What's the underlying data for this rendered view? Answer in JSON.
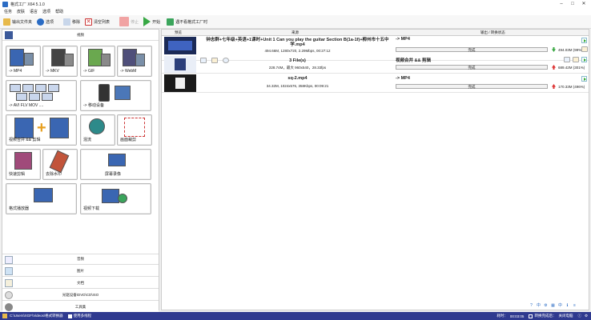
{
  "app": {
    "title": "格式工厂 X64 5.1.0"
  },
  "menu": [
    "任务",
    "皮肤",
    "语言",
    "选项",
    "帮助"
  ],
  "toolbar": {
    "output_folder": "输出文件夹",
    "options": "选项",
    "remove": "移除",
    "clear_list": "清空列表",
    "stop": "停止",
    "start": "开始",
    "download_label": "遇不看格式工厂时"
  },
  "left": {
    "video_header": "视频",
    "tiles": [
      {
        "label": "-> MP4"
      },
      {
        "label": "-> MKV"
      },
      {
        "label": "-> GIF"
      },
      {
        "label": "-> WebM"
      },
      {
        "label": "-> AVI FLV MOV ...."
      },
      {
        "label": "-> 移动设备"
      },
      {
        "label": "视频合并 && 剪辑"
      },
      {
        "label": "混流"
      },
      {
        "label": "画面裁剪"
      },
      {
        "label": "快速剪辑"
      },
      {
        "label": "去除水印"
      },
      {
        "label": "屏幕录像"
      },
      {
        "label": "格式播放器"
      },
      {
        "label": "视频下载"
      }
    ],
    "categories": [
      "音频",
      "图片",
      "文档",
      "光驱设备\\DVD\\CD\\ISO",
      "工具集"
    ]
  },
  "table": {
    "headers": {
      "preview": "预览",
      "source": "来源",
      "output": "输出 / 转换状态"
    },
    "rows": [
      {
        "name": "钟志群+七年级+英语+1课时+Unit 1 Can you play the guitar Section B(1a-1f)+柳州市十五中学.mp4",
        "info": "494.66M, 1280x720, 2.29Mbps, 00:27:12",
        "format": "-> MP4",
        "status": "完成",
        "size": "494.03M",
        "percent": "(99%)"
      },
      {
        "name": "3 File(s)",
        "info": "228.74M，最大 960x540，28.33fps",
        "format": "视频合并 && 剪辑",
        "status": "完成",
        "size": "689.42M",
        "percent": "(301%)"
      },
      {
        "name": "sq-2.mp4",
        "info": "34.32M, 1024x576, 358Kbps, 00:09:21",
        "format": "-> MP4",
        "status": "完成",
        "size": "170.33M",
        "percent": "(496%)"
      }
    ]
  },
  "status": {
    "path": "C:\\Users\\XGF\\Videos\\格式转换器",
    "use_multithread": "使用多线程",
    "elapsed_label": "耗时：",
    "elapsed": "00:03:05",
    "after_convert": "转换完成后：",
    "after_action": "关闭电脑"
  }
}
